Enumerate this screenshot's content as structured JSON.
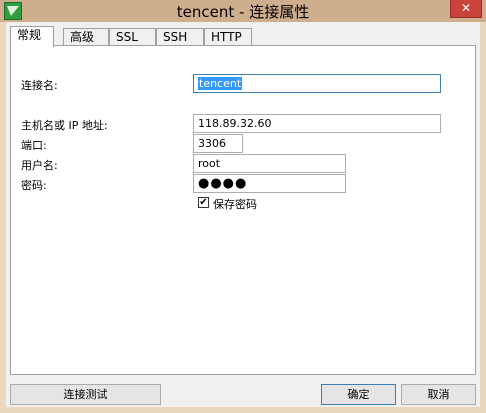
{
  "window": {
    "title": "tencent - 连接属性",
    "close_glyph": "✕"
  },
  "tabs": [
    {
      "label": "常规",
      "active": true
    },
    {
      "label": "高级",
      "active": false
    },
    {
      "label": "SSL",
      "active": false
    },
    {
      "label": "SSH",
      "active": false
    },
    {
      "label": "HTTP",
      "active": false
    }
  ],
  "form": {
    "connection_name_label": "连接名:",
    "connection_name_value": "tencent",
    "host_label": "主机名或 IP 地址:",
    "host_value": "118.89.32.60",
    "port_label": "端口:",
    "port_value": "3306",
    "user_label": "用户名:",
    "user_value": "root",
    "password_label": "密码:",
    "password_value": "●●●●",
    "save_password_label": "保存密码",
    "save_password_checked": true,
    "check_glyph": "✔"
  },
  "buttons": {
    "test_connection": "连接测试",
    "ok": "确定",
    "cancel": "取消"
  },
  "colors": {
    "titlebar": "#cfae8e",
    "close_button": "#c9433a",
    "selection": "#3399ff",
    "focus_border": "#3c7fb1"
  }
}
